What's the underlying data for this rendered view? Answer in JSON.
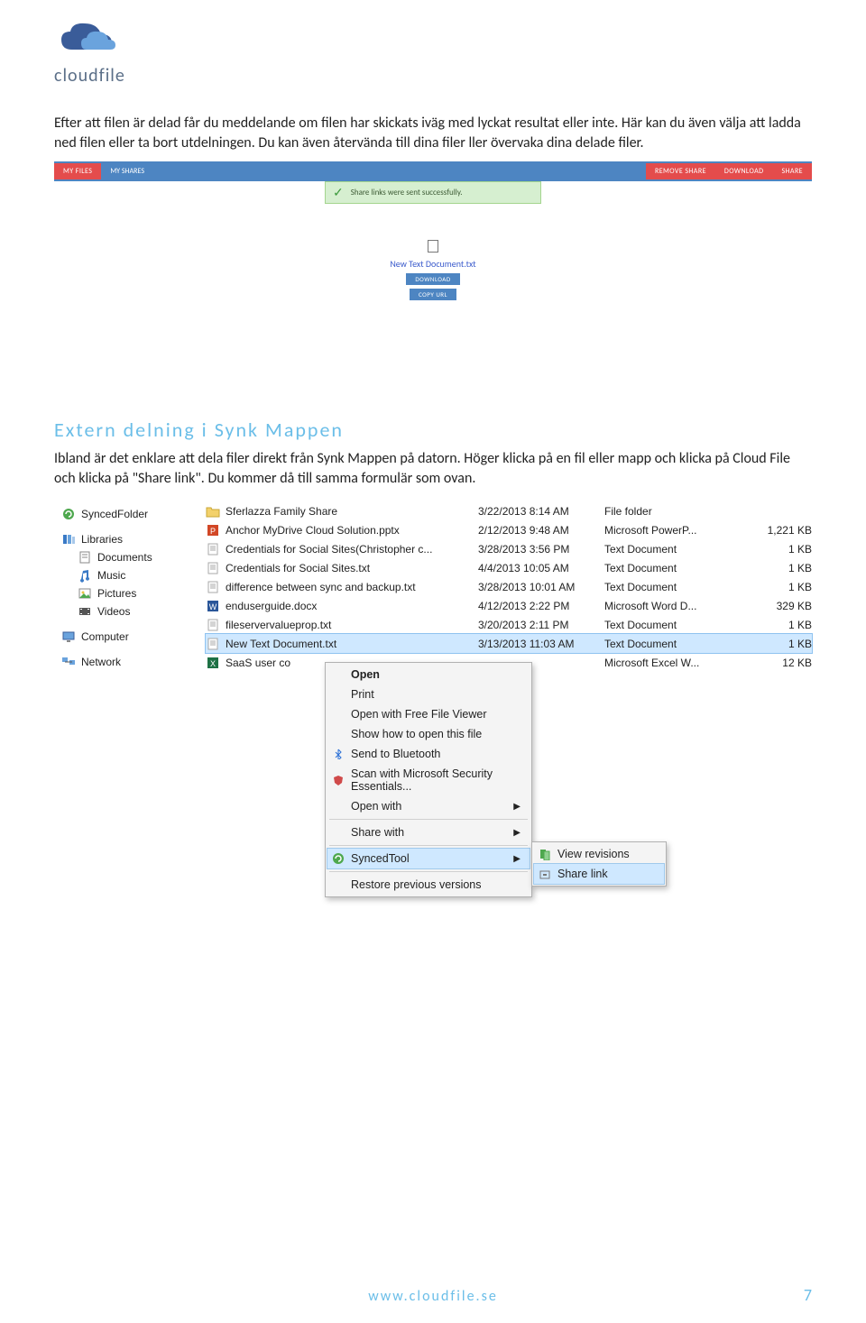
{
  "logo": {
    "text": "cloudfile"
  },
  "para1": "Efter att filen är delad får du meddelande om filen har skickats iväg med lyckat resultat eller inte. Här kan du även välja att ladda ned filen eller ta bort utdelningen. Du kan även återvända till dina filer ller övervaka dina delade filer.",
  "shot1": {
    "tabs": {
      "myfiles": "MY FILES",
      "myshares": "MY SHARES"
    },
    "rightbtns": {
      "remove": "REMOVE SHARE",
      "download": "DOWNLOAD",
      "share": "SHARE"
    },
    "success": "Share links were sent successfully.",
    "filename": "New Text Document.txt",
    "btn_download": "DOWNLOAD",
    "btn_copy": "COPY URL"
  },
  "heading": "Extern delning i Synk Mappen",
  "para2": "Ibland är det enklare att dela filer direkt från Synk Mappen på datorn. Höger klicka på en fil eller mapp och klicka på Cloud File och klicka på \"Share link\". Du kommer då till samma formulär som ovan.",
  "explorer": {
    "nav": {
      "synced": "SyncedFolder",
      "libraries": "Libraries",
      "documents": "Documents",
      "music": "Music",
      "pictures": "Pictures",
      "videos": "Videos",
      "computer": "Computer",
      "network": "Network"
    },
    "files": [
      {
        "icon": "folder",
        "name": "Sferlazza Family Share",
        "date": "3/22/2013 8:14 AM",
        "type": "File folder",
        "size": ""
      },
      {
        "icon": "pptx",
        "name": "Anchor MyDrive Cloud Solution.pptx",
        "date": "2/12/2013 9:48 AM",
        "type": "Microsoft PowerP...",
        "size": "1,221 KB"
      },
      {
        "icon": "txt",
        "name": "Credentials for Social Sites(Christopher c...",
        "date": "3/28/2013 3:56 PM",
        "type": "Text Document",
        "size": "1 KB"
      },
      {
        "icon": "txt",
        "name": "Credentials for Social Sites.txt",
        "date": "4/4/2013 10:05 AM",
        "type": "Text Document",
        "size": "1 KB"
      },
      {
        "icon": "txt",
        "name": "difference between sync and backup.txt",
        "date": "3/28/2013 10:01 AM",
        "type": "Text Document",
        "size": "1 KB"
      },
      {
        "icon": "docx",
        "name": "enduserguide.docx",
        "date": "4/12/2013 2:22 PM",
        "type": "Microsoft Word D...",
        "size": "329 KB"
      },
      {
        "icon": "txt",
        "name": "fileservervalueprop.txt",
        "date": "3/20/2013 2:11 PM",
        "type": "Text Document",
        "size": "1 KB"
      },
      {
        "icon": "txt",
        "name": "New Text Document.txt",
        "date": "3/13/2013 11:03 AM",
        "type": "Text Document",
        "size": "1 KB",
        "selected": true
      },
      {
        "icon": "xlsx",
        "name": "SaaS user co",
        "date": "",
        "type": "Microsoft Excel W...",
        "size": "12 KB"
      }
    ],
    "menu": {
      "open": "Open",
      "print": "Print",
      "freeviewer": "Open with Free File Viewer",
      "showhow": "Show how to open this file",
      "bluetooth": "Send to Bluetooth",
      "scan": "Scan with Microsoft Security Essentials...",
      "openwith": "Open with",
      "sharewith": "Share with",
      "syncedtool": "SyncedTool",
      "restore": "Restore previous versions"
    },
    "submenu": {
      "revisions": "View revisions",
      "sharelink": "Share link"
    }
  },
  "footer": {
    "url": "www.cloudfile.se",
    "page": "7"
  }
}
